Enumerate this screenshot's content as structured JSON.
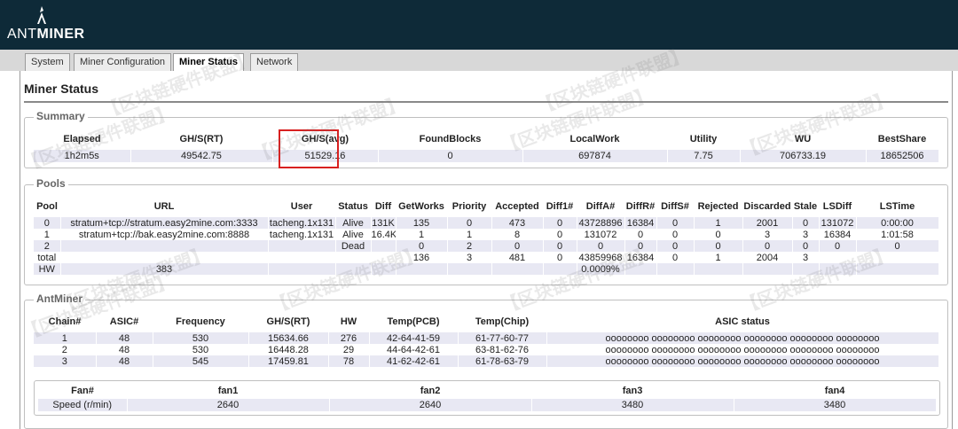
{
  "brand": {
    "prefix": "ANT",
    "suffix": "MINER"
  },
  "tabs": [
    {
      "label": "System"
    },
    {
      "label": "Miner Configuration"
    },
    {
      "label": "Miner Status"
    },
    {
      "label": "Network"
    }
  ],
  "page_title": "Miner Status",
  "summary": {
    "legend": "Summary",
    "headers": [
      "Elapsed",
      "GH/S(RT)",
      "GH/S(avg)",
      "FoundBlocks",
      "LocalWork",
      "Utility",
      "WU",
      "BestShare"
    ],
    "values": [
      "1h2m5s",
      "49542.75",
      "51529.16",
      "0",
      "697874",
      "7.75",
      "706733.19",
      "18652506"
    ]
  },
  "pools": {
    "legend": "Pools",
    "headers": [
      "Pool",
      "URL",
      "User",
      "Status",
      "Diff",
      "GetWorks",
      "Priority",
      "Accepted",
      "Diff1#",
      "DiffA#",
      "DiffR#",
      "DiffS#",
      "Rejected",
      "Discarded",
      "Stale",
      "LSDiff",
      "LSTime"
    ],
    "rows": [
      [
        "0",
        "stratum+tcp://stratum.easy2mine.com:3333",
        "tacheng.1x131",
        "Alive",
        "131K",
        "135",
        "0",
        "473",
        "0",
        "43728896",
        "16384",
        "0",
        "1",
        "2001",
        "0",
        "131072",
        "0:00:00"
      ],
      [
        "1",
        "stratum+tcp://bak.easy2mine.com:8888",
        "tacheng.1x131",
        "Alive",
        "16.4K",
        "1",
        "1",
        "8",
        "0",
        "131072",
        "0",
        "0",
        "0",
        "3",
        "3",
        "16384",
        "1:01:58"
      ],
      [
        "2",
        "",
        "",
        "Dead",
        "",
        "0",
        "2",
        "0",
        "0",
        "0",
        "0",
        "0",
        "0",
        "0",
        "0",
        "0",
        "0"
      ],
      [
        "total",
        "",
        "",
        "",
        "",
        "136",
        "3",
        "481",
        "0",
        "43859968",
        "16384",
        "0",
        "1",
        "2004",
        "3",
        "",
        ""
      ],
      [
        "HW",
        "383",
        "",
        "",
        "",
        "",
        "",
        "",
        "",
        "0.0009%",
        "",
        "",
        "",
        "",
        "",
        "",
        ""
      ]
    ]
  },
  "antminer": {
    "legend": "AntMiner",
    "headers": [
      "Chain#",
      "ASIC#",
      "Frequency",
      "GH/S(RT)",
      "HW",
      "Temp(PCB)",
      "Temp(Chip)",
      "ASIC status"
    ],
    "rows": [
      [
        "1",
        "48",
        "530",
        "15634.66",
        "276",
        "42-64-41-59",
        "61-77-60-77",
        "oooooooo oooooooo oooooooo oooooooo oooooooo oooooooo"
      ],
      [
        "2",
        "48",
        "530",
        "16448.28",
        "29",
        "44-64-42-61",
        "63-81-62-76",
        "oooooooo oooooooo oooooooo oooooooo oooooooo oooooooo"
      ],
      [
        "3",
        "48",
        "545",
        "17459.81",
        "78",
        "41-62-42-61",
        "61-78-63-79",
        "oooooooo oooooooo oooooooo oooooooo oooooooo oooooooo"
      ]
    ]
  },
  "fans": {
    "headers": [
      "Fan#",
      "fan1",
      "fan2",
      "fan3",
      "fan4"
    ],
    "values": [
      "Speed (r/min)",
      "2640",
      "2640",
      "3480",
      "3480"
    ]
  },
  "watermark": "【区块链硬件联盟】"
}
